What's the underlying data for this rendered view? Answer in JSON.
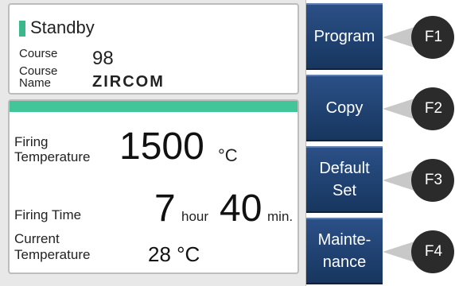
{
  "status": {
    "state": "Standby",
    "course_label": "Course",
    "course_value": "98",
    "course_name_label_1": "Course",
    "course_name_label_2": "Name",
    "course_name_value": "ZIRCOM"
  },
  "firing": {
    "temp_label_1": "Firing",
    "temp_label_2": "Temperature",
    "temp_value": "1500",
    "temp_unit": "°C",
    "time_label": "Firing Time",
    "hours_value": "7",
    "hours_unit": "hour",
    "minutes_value": "40",
    "minutes_unit": "min.",
    "current_label_1": "Current",
    "current_label_2": "Temperature",
    "current_value": "28 °C"
  },
  "function_keys": [
    {
      "label": "Program",
      "key": "F1"
    },
    {
      "label": "Copy",
      "key": "F2"
    },
    {
      "label_line1": "Default",
      "label_line2": "Set",
      "key": "F3"
    },
    {
      "label_line1": "Mainte-",
      "label_line2": "nance",
      "key": "F4"
    }
  ],
  "colors": {
    "accent_green": "#43c59a",
    "key_blue": "#1f3f6e",
    "fkey_dark": "#2b2b2b"
  }
}
